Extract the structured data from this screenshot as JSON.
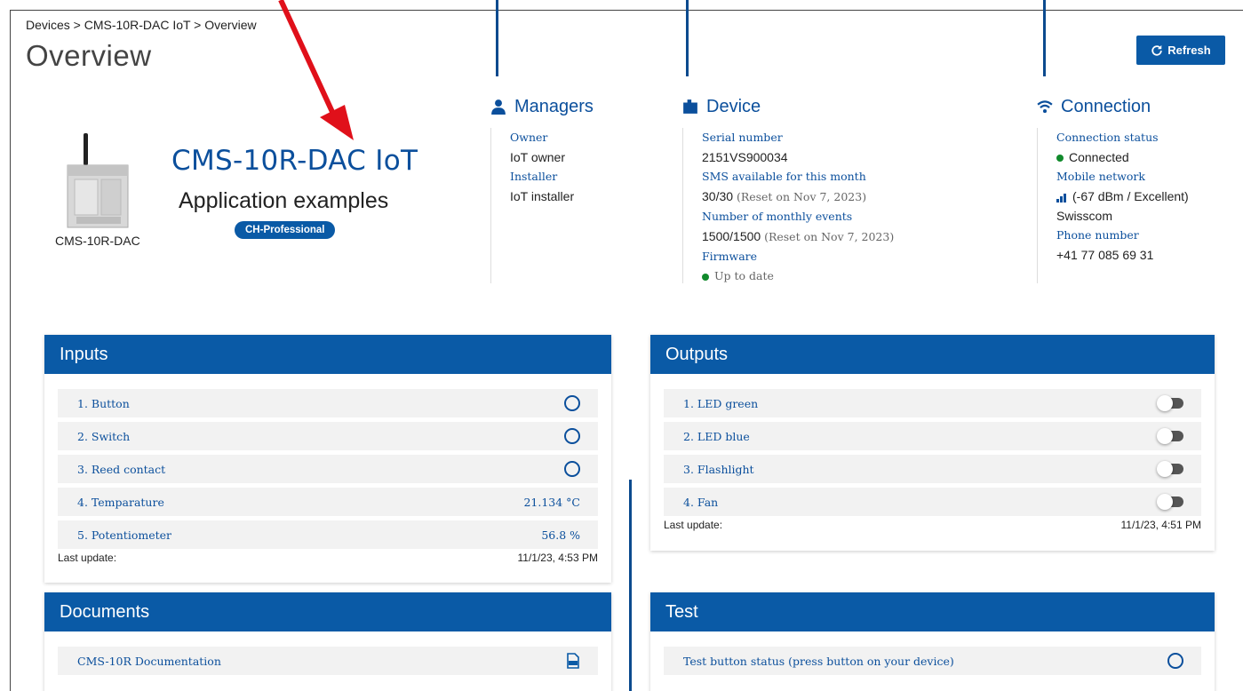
{
  "breadcrumb": "Devices > CMS-10R-DAC IoT > Overview",
  "page_title": "Overview",
  "refresh_label": "Refresh",
  "device": {
    "caption": "CMS-10R-DAC",
    "name": "CMS-10R-DAC IoT",
    "subtitle": "Application examples",
    "badge": "CH-Professional"
  },
  "managers": {
    "title": "Managers",
    "owner_label": "Owner",
    "owner_value": "IoT owner",
    "installer_label": "Installer",
    "installer_value": "IoT installer"
  },
  "device_info": {
    "title": "Device",
    "serial_label": "Serial number",
    "serial_value": "2151VS900034",
    "sms_label": "SMS available for this month",
    "sms_value": "30/30",
    "sms_note": "(Reset on Nov 7, 2023)",
    "events_label": "Number of monthly events",
    "events_value": "1500/1500",
    "events_note": "(Reset on Nov 7, 2023)",
    "firmware_label": "Firmware",
    "firmware_value": "Up to date"
  },
  "connection": {
    "title": "Connection",
    "status_label": "Connection status",
    "status_value": "Connected",
    "network_label": "Mobile network",
    "network_value": "(-67 dBm / Excellent)",
    "operator": "Swisscom",
    "phone_label": "Phone number",
    "phone_value": "+41 77 085 69 31"
  },
  "inputs": {
    "title": "Inputs",
    "items": [
      {
        "label": "1. Button",
        "type": "circle"
      },
      {
        "label": "2. Switch",
        "type": "circle"
      },
      {
        "label": "3. Reed contact",
        "type": "circle"
      },
      {
        "label": "4. Temparature",
        "value": "21.134 °C"
      },
      {
        "label": "5. Potentiometer",
        "value": "56.8 %"
      }
    ],
    "last_update_label": "Last update:",
    "last_update_value": "11/1/23, 4:53 PM"
  },
  "outputs": {
    "title": "Outputs",
    "items": [
      {
        "label": "1. LED green"
      },
      {
        "label": "2. LED blue"
      },
      {
        "label": "3. Flashlight"
      },
      {
        "label": "4. Fan"
      }
    ],
    "last_update_label": "Last update:",
    "last_update_value": "11/1/23, 4:51 PM"
  },
  "documents": {
    "title": "Documents",
    "items": [
      {
        "label": "CMS-10R Documentation"
      }
    ]
  },
  "test": {
    "title": "Test",
    "items": [
      {
        "label": "Test button status (press button on your device)"
      }
    ]
  },
  "colors": {
    "primary": "#0a5aa6",
    "link": "#0b4f9c",
    "annotation_arrow": "#e0101a",
    "status_ok": "#118a2c"
  }
}
